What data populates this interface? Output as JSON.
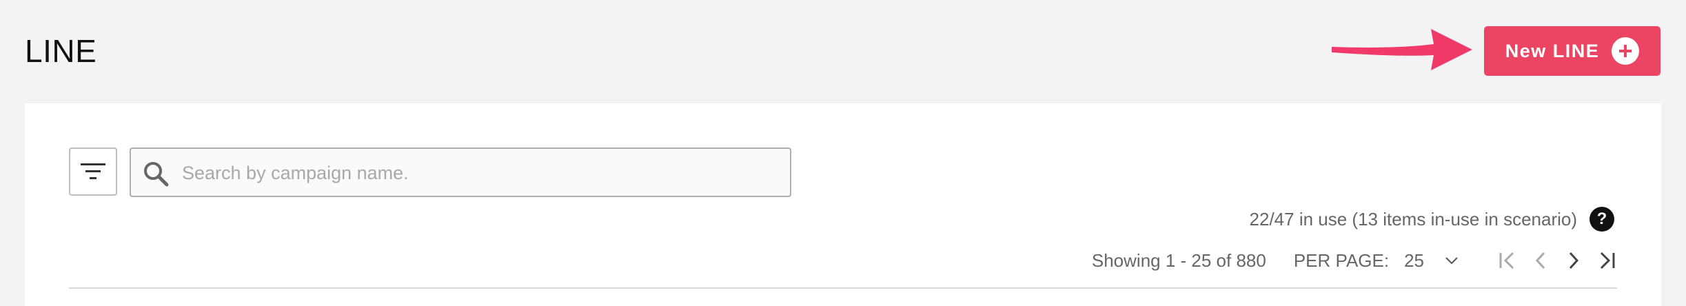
{
  "header": {
    "title": "LINE",
    "new_button_label": "New LINE"
  },
  "search": {
    "placeholder": "Search by campaign name.",
    "value": ""
  },
  "usage": {
    "text": "22/47 in use (13 items in-use in scenario)",
    "help_glyph": "?"
  },
  "pagination": {
    "showing": "Showing 1 - 25 of 880",
    "per_page_label": "PER PAGE:",
    "per_page_value": "25"
  },
  "colors": {
    "accent": "#ec4563",
    "arrow": "#f23a6a"
  },
  "icons": {
    "filter": "filter-icon",
    "search": "search-icon",
    "plus": "plus-circle-icon",
    "help": "question-circle-icon",
    "first": "first-page-icon",
    "prev": "chevron-left-icon",
    "next": "chevron-right-icon",
    "last": "last-page-icon",
    "dropdown": "chevron-down-icon",
    "annotation_arrow": "arrow-right-icon"
  }
}
